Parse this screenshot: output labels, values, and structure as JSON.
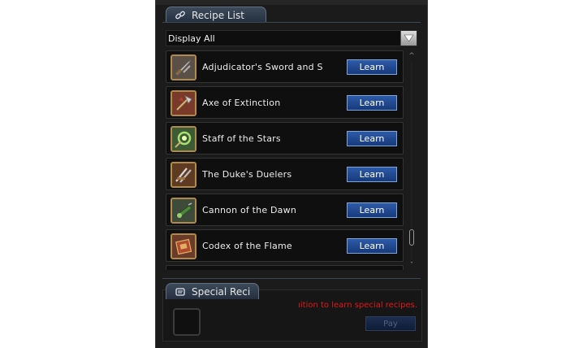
{
  "recipe_tab": {
    "label": "Recipe List",
    "icon": "link-icon"
  },
  "filter": {
    "selected": "Display All"
  },
  "recipes": [
    {
      "name": "Adjudicator's Sword and S",
      "action": "Learn",
      "icon": "sword-icon"
    },
    {
      "name": "Axe of Extinction",
      "action": "Learn",
      "icon": "axe-icon"
    },
    {
      "name": "Staff of the Stars",
      "action": "Learn",
      "icon": "staff-icon"
    },
    {
      "name": "The Duke's Duelers",
      "action": "Learn",
      "icon": "dual-blades-icon"
    },
    {
      "name": "Cannon of the Dawn",
      "action": "Learn",
      "icon": "cannon-icon"
    },
    {
      "name": "Codex of the Flame",
      "action": "Learn",
      "icon": "codex-icon"
    }
  ],
  "special_tab": {
    "label": "Special Reci",
    "icon": "scroll-icon"
  },
  "special": {
    "message": "ıition to learn special recipes.",
    "pay_label": "Pay"
  },
  "colors": {
    "accent": "#2e5aa8",
    "warning": "#e01818",
    "frame": "#b08a4a"
  }
}
